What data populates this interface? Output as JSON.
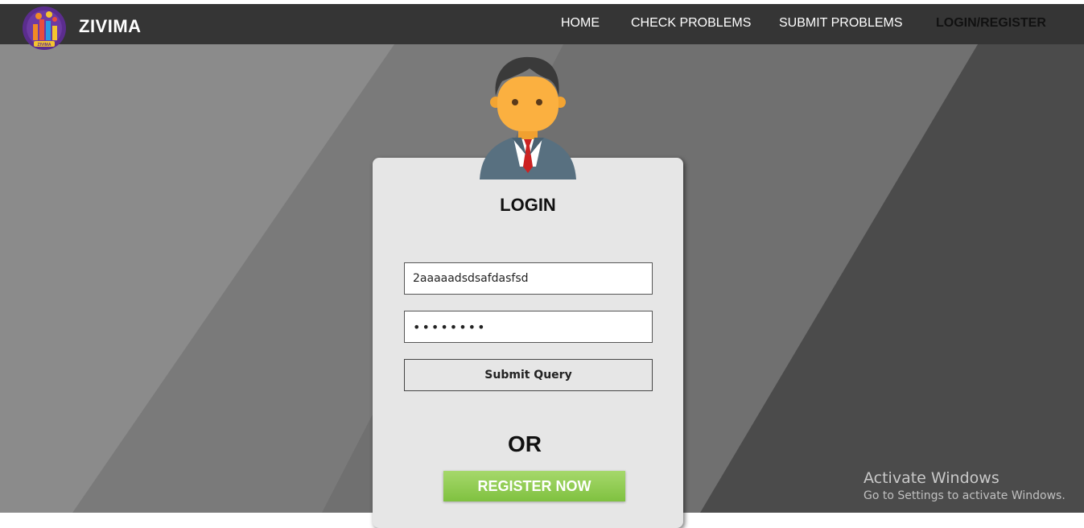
{
  "brand": {
    "name": "ZIVIMA",
    "logo_text": "ZIVIMA"
  },
  "nav": {
    "items": [
      {
        "label": "HOME",
        "active": false
      },
      {
        "label": "CHECK PROBLEMS",
        "active": false
      },
      {
        "label": "SUBMIT PROBLEMS",
        "active": false
      },
      {
        "label": "LOGIN/REGISTER",
        "active": true
      }
    ]
  },
  "login": {
    "title": "LOGIN",
    "username_value": "2aaaaadsdsafdasfsd",
    "password_value": "••••••••",
    "submit_label": "Submit Query",
    "or_text": "OR",
    "register_label": "REGISTER NOW"
  },
  "watermark": {
    "title": "Activate Windows",
    "subtitle": "Go to Settings to activate Windows."
  },
  "icons": {
    "logo": "zivima-logo-icon",
    "avatar": "user-avatar-icon"
  },
  "colors": {
    "navbar": "#353535",
    "card": "#e6e6e6",
    "register_button": "#8fcb52"
  }
}
